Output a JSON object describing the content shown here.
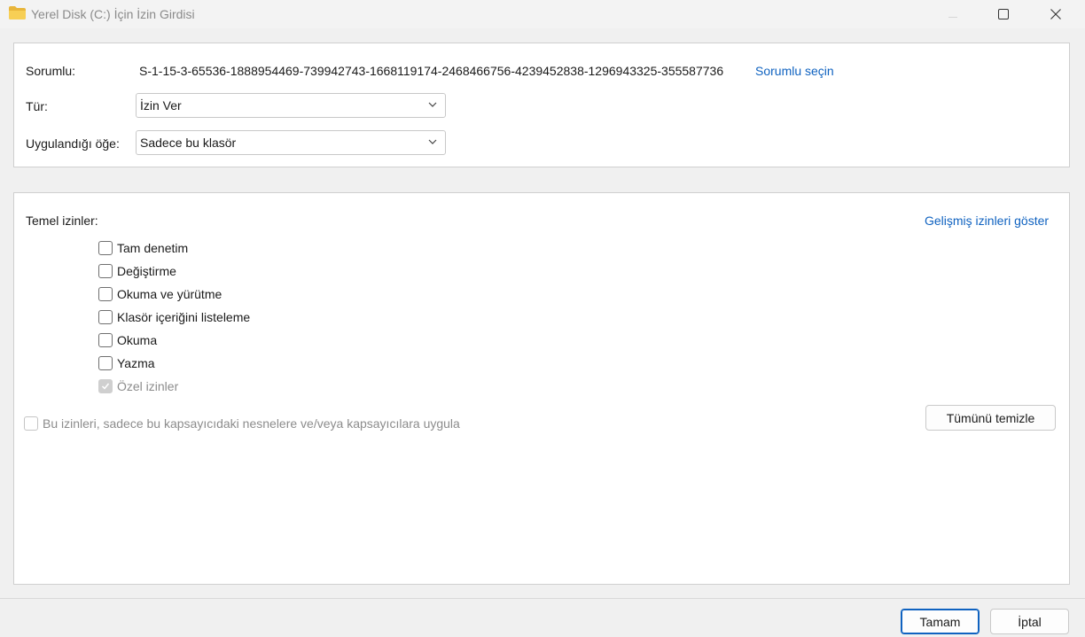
{
  "window": {
    "title": "Yerel Disk (C:) İçin İzin Girdisi",
    "icon": "folder-icon"
  },
  "principal": {
    "label": "Sorumlu:",
    "value": "S-1-15-3-65536-1888954469-739942743-1668119174-2468466756-4239452838-1296943325-355587736",
    "select_link": "Sorumlu seçin"
  },
  "type": {
    "label": "Tür:",
    "selected": "İzin Ver"
  },
  "applies_to": {
    "label": "Uygulandığı öğe:",
    "selected": "Sadece bu klasör"
  },
  "permissions": {
    "heading": "Temel izinler:",
    "advanced_link": "Gelişmiş izinleri göster",
    "items": [
      {
        "label": "Tam denetim",
        "checked": false,
        "disabled": false
      },
      {
        "label": "Değiştirme",
        "checked": false,
        "disabled": false
      },
      {
        "label": "Okuma ve yürütme",
        "checked": false,
        "disabled": false
      },
      {
        "label": "Klasör içeriğini listeleme",
        "checked": false,
        "disabled": false
      },
      {
        "label": "Okuma",
        "checked": false,
        "disabled": false
      },
      {
        "label": "Yazma",
        "checked": false,
        "disabled": false
      },
      {
        "label": "Özel izinler",
        "checked": true,
        "disabled": true
      }
    ],
    "apply_only_label": "Bu izinleri, sadece bu kapsayıcıdaki nesnelere ve/veya kapsayıcılara uygula",
    "clear_all": "Tümünü temizle"
  },
  "footer": {
    "ok": "Tamam",
    "cancel": "İptal"
  },
  "colors": {
    "accent": "#0f62c0",
    "folder": "#f4c542"
  }
}
